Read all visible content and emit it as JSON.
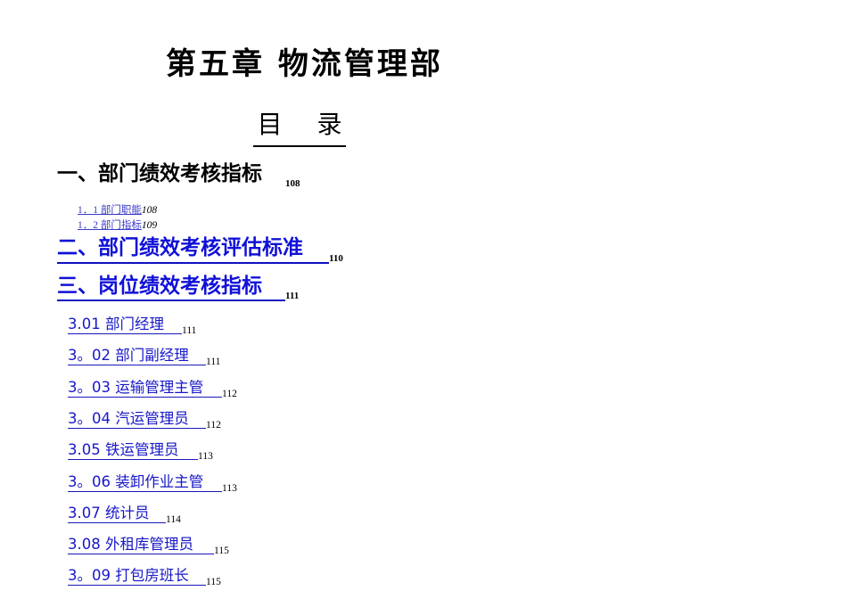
{
  "title": "第五章 物流管理部",
  "toc_title": "目 录",
  "sections": [
    {
      "label": "一、部门绩效考核指标",
      "page": "108"
    },
    {
      "label": "二、部门绩效考核评估标准",
      "page": "110"
    },
    {
      "label": "三、岗位绩效考核指标",
      "page": "111"
    }
  ],
  "subsections": [
    {
      "label": "1．1 部门职能",
      "page": "108"
    },
    {
      "label": "1．2 部门指标",
      "page": "109"
    }
  ],
  "items": [
    {
      "label": "3.01  部门经理",
      "page": "111"
    },
    {
      "label": "3。02  部门副经理",
      "page": "111"
    },
    {
      "label": "3。03  运输管理主管",
      "page": "112"
    },
    {
      "label": "3。04  汽运管理员",
      "page": "112"
    },
    {
      "label": "3.05  铁运管理员",
      "page": "113"
    },
    {
      "label": "3。06  装卸作业主管",
      "page": "113"
    },
    {
      "label": "3.07  统计员",
      "page": "114"
    },
    {
      "label": "3.08  外租库管理员",
      "page": "115"
    },
    {
      "label": "3。09  打包房班长",
      "page": "115"
    }
  ]
}
